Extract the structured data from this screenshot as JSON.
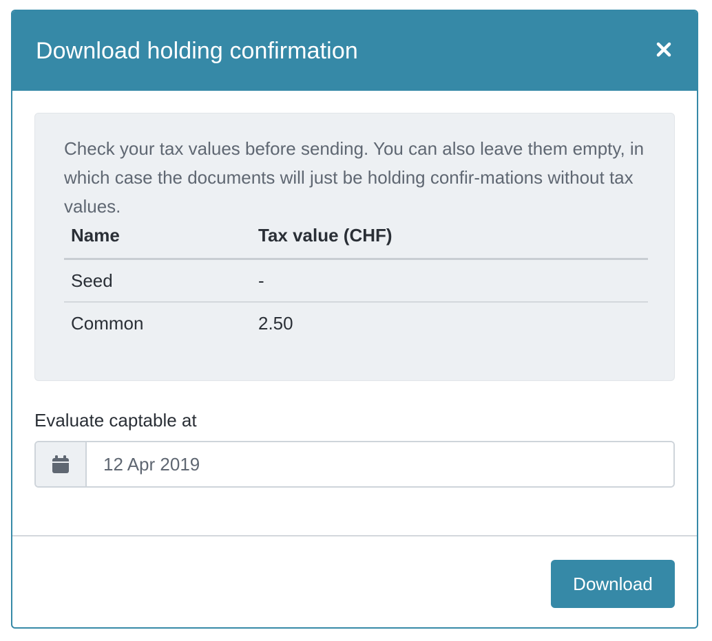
{
  "modal": {
    "title": "Download holding confirmation",
    "close_icon": "close-icon",
    "accent_color": "#3689a7"
  },
  "info": {
    "text": "Check your tax values before sending. You can also leave them empty, in which case the documents will just be holding confir-mations without tax values."
  },
  "table": {
    "headers": [
      "Name",
      "Tax value (CHF)"
    ],
    "rows": [
      {
        "name": "Seed",
        "tax_value": "-"
      },
      {
        "name": "Common",
        "tax_value": "2.50"
      }
    ]
  },
  "date_field": {
    "label": "Evaluate captable at",
    "value": "12 Apr 2019",
    "icon": "calendar-icon"
  },
  "footer": {
    "download_label": "Download"
  }
}
